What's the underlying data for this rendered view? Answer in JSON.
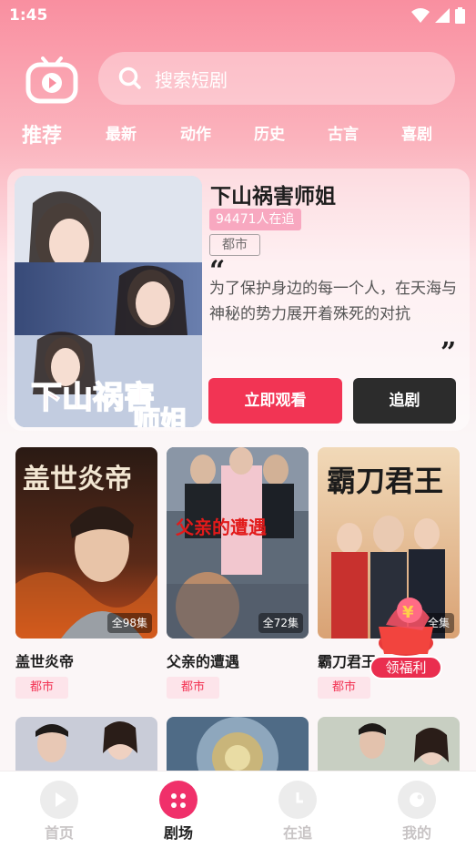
{
  "status": {
    "time": "1:45"
  },
  "search": {
    "placeholder": "搜索短剧"
  },
  "tabs": [
    {
      "label": "推荐",
      "active": true
    },
    {
      "label": "最新"
    },
    {
      "label": "动作"
    },
    {
      "label": "历史"
    },
    {
      "label": "古言"
    },
    {
      "label": "喜剧"
    }
  ],
  "featured": {
    "poster_text": "下山祸害",
    "poster_text_2": "师姐",
    "title": "下山祸害师姐",
    "followers": "94471人在追",
    "genre": "都市",
    "description": "为了保护身边的每一个人，在天海与神秘的势力展开着殊死的对抗",
    "watch_label": "立即观看",
    "follow_label": "追剧"
  },
  "cards": [
    {
      "title": "盖世炎帝",
      "episodes": "全98集",
      "tag": "都市",
      "poster_text": "盖世炎帝"
    },
    {
      "title": "父亲的遭遇",
      "episodes": "全72集",
      "tag": "都市",
      "poster_text": "父亲的遭遇"
    },
    {
      "title": "霸刀君王",
      "episodes": "全集",
      "tag": "都市",
      "poster_text": "霸刀君王"
    }
  ],
  "promo": {
    "label": "领福利"
  },
  "nav": [
    {
      "label": "首页",
      "active": false
    },
    {
      "label": "剧场",
      "active": true
    },
    {
      "label": "在追",
      "active": false
    },
    {
      "label": "我的",
      "active": false
    }
  ],
  "colors": {
    "accent": "#f23454",
    "header_gradient_top": "#f98fa0",
    "tag_bg": "#fde4ea",
    "dark_button": "#2c2c2c"
  }
}
